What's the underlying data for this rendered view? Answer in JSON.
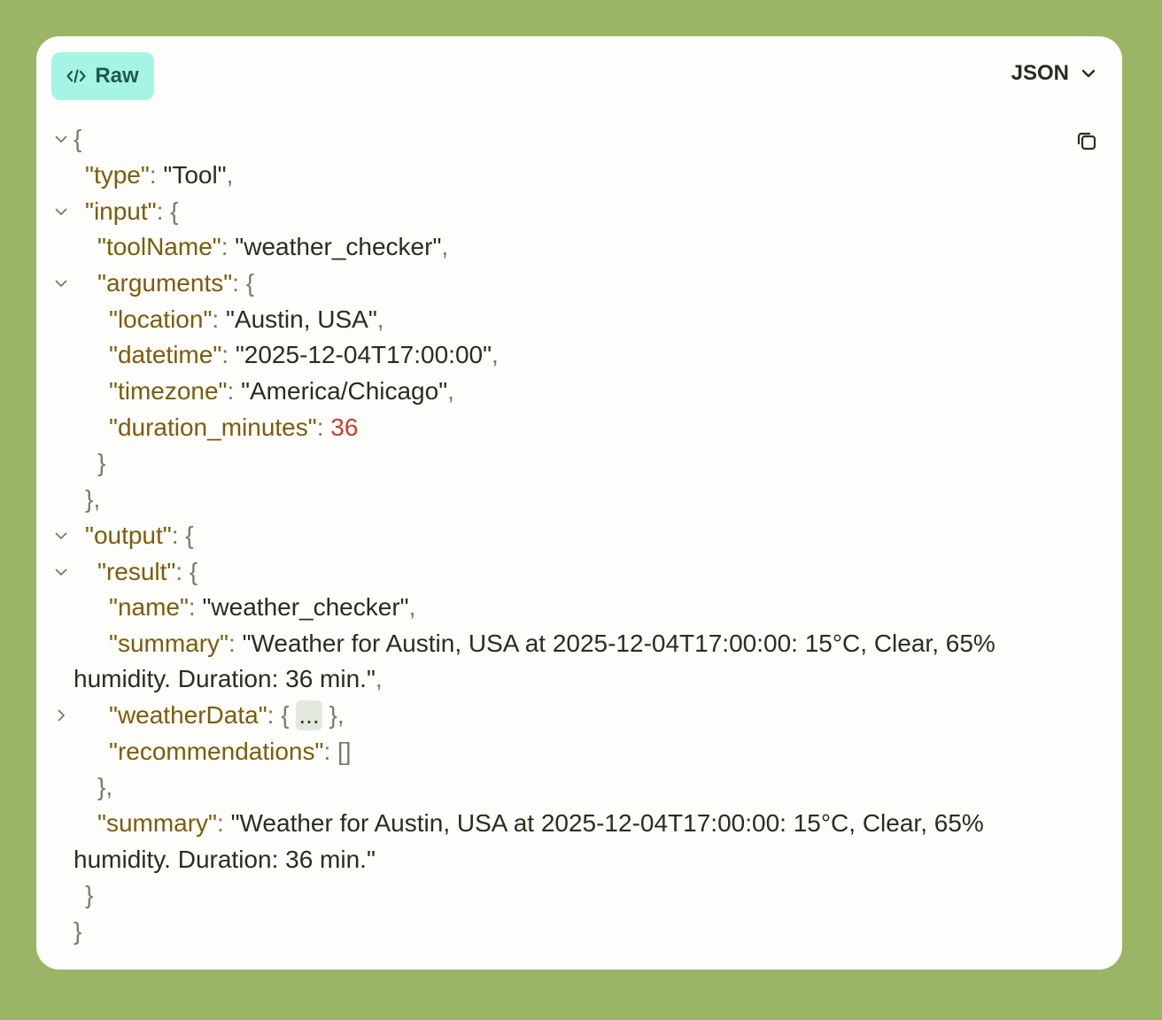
{
  "toolbar": {
    "raw_label": "Raw",
    "format_label": "JSON"
  },
  "icons": {
    "raw": "code-icon",
    "format": "chevron-down-icon",
    "copy": "copy-icon",
    "expanded": "chevron-down-icon",
    "collapsed": "chevron-right-icon"
  },
  "colors": {
    "background": "#9ab566",
    "card": "#fdfdfb",
    "raw_button": "#a6f4e3",
    "key": "#7c5c0b",
    "number": "#c2412b"
  },
  "json": {
    "type_key": "\"type\"",
    "type_value": "\"Tool\"",
    "input_key": "\"input\"",
    "toolName_key": "\"toolName\"",
    "toolName_value": "\"weather_checker\"",
    "arguments_key": "\"arguments\"",
    "location_key": "\"location\"",
    "location_value": "\"Austin, USA\"",
    "datetime_key": "\"datetime\"",
    "datetime_value": "\"2025-12-04T17:00:00\"",
    "timezone_key": "\"timezone\"",
    "timezone_value": "\"America/Chicago\"",
    "duration_key": "\"duration_minutes\"",
    "duration_value": "36",
    "output_key": "\"output\"",
    "result_key": "\"result\"",
    "name_key": "\"name\"",
    "name_value": "\"weather_checker\"",
    "summary_key": "\"summary\"",
    "result_summary_line1": "\"Weather for Austin, USA at 2025-12-04T17:00:00: 15°C, Clear, 65%",
    "result_summary_line2": "humidity. Duration: 36 min.\"",
    "weatherData_key": "\"weatherData\"",
    "weatherData_collapsed": "...",
    "recommendations_key": "\"recommendations\"",
    "recommendations_value": "[]",
    "output_summary_line1": "\"Weather for Austin, USA at 2025-12-04T17:00:00: 15°C, Clear, 65%",
    "output_summary_line2": "humidity. Duration: 36 min.\""
  }
}
